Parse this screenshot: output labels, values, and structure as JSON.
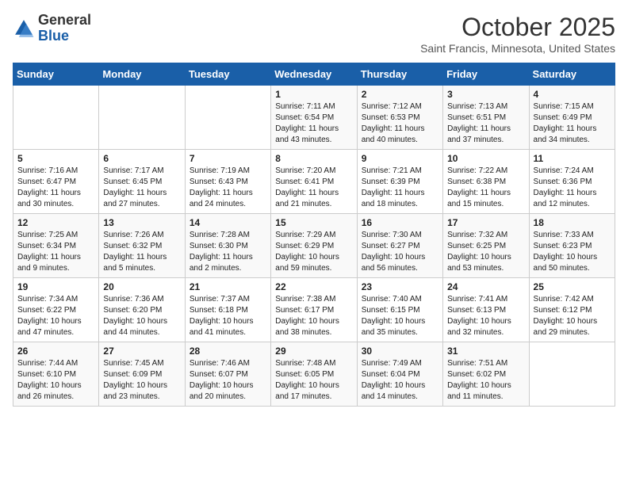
{
  "header": {
    "logo_general": "General",
    "logo_blue": "Blue",
    "month": "October 2025",
    "subtitle": "Saint Francis, Minnesota, United States"
  },
  "days_of_week": [
    "Sunday",
    "Monday",
    "Tuesday",
    "Wednesday",
    "Thursday",
    "Friday",
    "Saturday"
  ],
  "weeks": [
    [
      {
        "day": "",
        "text": ""
      },
      {
        "day": "",
        "text": ""
      },
      {
        "day": "",
        "text": ""
      },
      {
        "day": "1",
        "text": "Sunrise: 7:11 AM\nSunset: 6:54 PM\nDaylight: 11 hours\nand 43 minutes."
      },
      {
        "day": "2",
        "text": "Sunrise: 7:12 AM\nSunset: 6:53 PM\nDaylight: 11 hours\nand 40 minutes."
      },
      {
        "day": "3",
        "text": "Sunrise: 7:13 AM\nSunset: 6:51 PM\nDaylight: 11 hours\nand 37 minutes."
      },
      {
        "day": "4",
        "text": "Sunrise: 7:15 AM\nSunset: 6:49 PM\nDaylight: 11 hours\nand 34 minutes."
      }
    ],
    [
      {
        "day": "5",
        "text": "Sunrise: 7:16 AM\nSunset: 6:47 PM\nDaylight: 11 hours\nand 30 minutes."
      },
      {
        "day": "6",
        "text": "Sunrise: 7:17 AM\nSunset: 6:45 PM\nDaylight: 11 hours\nand 27 minutes."
      },
      {
        "day": "7",
        "text": "Sunrise: 7:19 AM\nSunset: 6:43 PM\nDaylight: 11 hours\nand 24 minutes."
      },
      {
        "day": "8",
        "text": "Sunrise: 7:20 AM\nSunset: 6:41 PM\nDaylight: 11 hours\nand 21 minutes."
      },
      {
        "day": "9",
        "text": "Sunrise: 7:21 AM\nSunset: 6:39 PM\nDaylight: 11 hours\nand 18 minutes."
      },
      {
        "day": "10",
        "text": "Sunrise: 7:22 AM\nSunset: 6:38 PM\nDaylight: 11 hours\nand 15 minutes."
      },
      {
        "day": "11",
        "text": "Sunrise: 7:24 AM\nSunset: 6:36 PM\nDaylight: 11 hours\nand 12 minutes."
      }
    ],
    [
      {
        "day": "12",
        "text": "Sunrise: 7:25 AM\nSunset: 6:34 PM\nDaylight: 11 hours\nand 9 minutes."
      },
      {
        "day": "13",
        "text": "Sunrise: 7:26 AM\nSunset: 6:32 PM\nDaylight: 11 hours\nand 5 minutes."
      },
      {
        "day": "14",
        "text": "Sunrise: 7:28 AM\nSunset: 6:30 PM\nDaylight: 11 hours\nand 2 minutes."
      },
      {
        "day": "15",
        "text": "Sunrise: 7:29 AM\nSunset: 6:29 PM\nDaylight: 10 hours\nand 59 minutes."
      },
      {
        "day": "16",
        "text": "Sunrise: 7:30 AM\nSunset: 6:27 PM\nDaylight: 10 hours\nand 56 minutes."
      },
      {
        "day": "17",
        "text": "Sunrise: 7:32 AM\nSunset: 6:25 PM\nDaylight: 10 hours\nand 53 minutes."
      },
      {
        "day": "18",
        "text": "Sunrise: 7:33 AM\nSunset: 6:23 PM\nDaylight: 10 hours\nand 50 minutes."
      }
    ],
    [
      {
        "day": "19",
        "text": "Sunrise: 7:34 AM\nSunset: 6:22 PM\nDaylight: 10 hours\nand 47 minutes."
      },
      {
        "day": "20",
        "text": "Sunrise: 7:36 AM\nSunset: 6:20 PM\nDaylight: 10 hours\nand 44 minutes."
      },
      {
        "day": "21",
        "text": "Sunrise: 7:37 AM\nSunset: 6:18 PM\nDaylight: 10 hours\nand 41 minutes."
      },
      {
        "day": "22",
        "text": "Sunrise: 7:38 AM\nSunset: 6:17 PM\nDaylight: 10 hours\nand 38 minutes."
      },
      {
        "day": "23",
        "text": "Sunrise: 7:40 AM\nSunset: 6:15 PM\nDaylight: 10 hours\nand 35 minutes."
      },
      {
        "day": "24",
        "text": "Sunrise: 7:41 AM\nSunset: 6:13 PM\nDaylight: 10 hours\nand 32 minutes."
      },
      {
        "day": "25",
        "text": "Sunrise: 7:42 AM\nSunset: 6:12 PM\nDaylight: 10 hours\nand 29 minutes."
      }
    ],
    [
      {
        "day": "26",
        "text": "Sunrise: 7:44 AM\nSunset: 6:10 PM\nDaylight: 10 hours\nand 26 minutes."
      },
      {
        "day": "27",
        "text": "Sunrise: 7:45 AM\nSunset: 6:09 PM\nDaylight: 10 hours\nand 23 minutes."
      },
      {
        "day": "28",
        "text": "Sunrise: 7:46 AM\nSunset: 6:07 PM\nDaylight: 10 hours\nand 20 minutes."
      },
      {
        "day": "29",
        "text": "Sunrise: 7:48 AM\nSunset: 6:05 PM\nDaylight: 10 hours\nand 17 minutes."
      },
      {
        "day": "30",
        "text": "Sunrise: 7:49 AM\nSunset: 6:04 PM\nDaylight: 10 hours\nand 14 minutes."
      },
      {
        "day": "31",
        "text": "Sunrise: 7:51 AM\nSunset: 6:02 PM\nDaylight: 10 hours\nand 11 minutes."
      },
      {
        "day": "",
        "text": ""
      }
    ]
  ]
}
